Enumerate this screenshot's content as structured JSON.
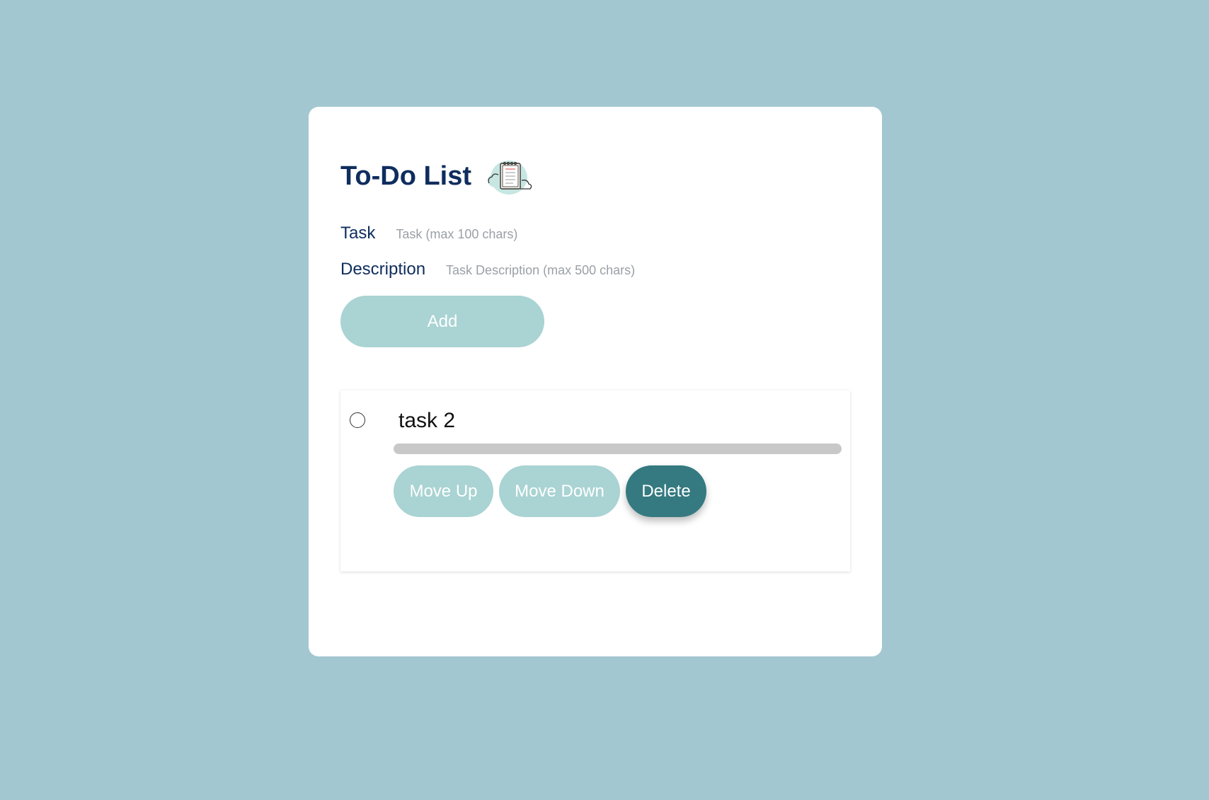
{
  "app": {
    "title": "To-Do List",
    "title_icon": "notebook-icon"
  },
  "form": {
    "task_label": "Task",
    "task_placeholder": "Task (max 100 chars)",
    "task_value": "",
    "description_label": "Description",
    "description_placeholder": "Task Description (max 500 chars)",
    "description_value": "",
    "add_label": "Add"
  },
  "tasks": [
    {
      "name": "task 2",
      "completed": false,
      "actions": {
        "move_up": "Move Up",
        "move_down": "Move Down",
        "delete": "Delete"
      }
    }
  ],
  "colors": {
    "background": "#a3c7d0",
    "card": "#ffffff",
    "title": "#0f2d5e",
    "button_light": "#aad3d3",
    "button_dark": "#357a80",
    "bar": "#c8c8c8"
  }
}
